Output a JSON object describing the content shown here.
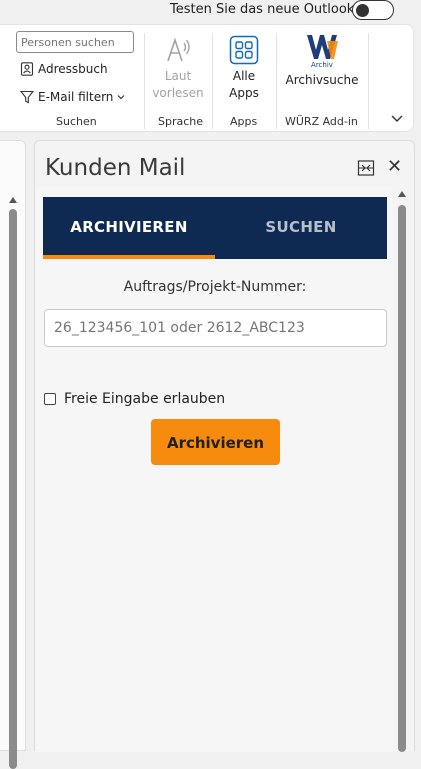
{
  "top": {
    "outlook_toggle_text": "Testen Sie das neue Outlook",
    "outlook_toggle_on": false
  },
  "ribbon": {
    "search_group": {
      "search_placeholder": "Personen suchen",
      "address_book": "Adressbuch",
      "filter_email": "E-Mail filtern",
      "group_label": "Suchen"
    },
    "speech_group": {
      "read_aloud_line1": "Laut",
      "read_aloud_line2": "vorlesen",
      "group_label": "Sprache"
    },
    "apps_group": {
      "all_apps_line1": "Alle",
      "all_apps_line2": "Apps",
      "group_label": "Apps"
    },
    "wurz_group": {
      "logo_text": "Archiv",
      "archive_search": "Archivsuche",
      "group_label": "WÜRZ Add-in"
    }
  },
  "pane": {
    "title": "Kunden Mail",
    "tabs": [
      {
        "label": "ARCHIVIEREN",
        "active": true
      },
      {
        "label": "SUCHEN",
        "active": false
      }
    ],
    "order_label": "Auftrags/Projekt-Nummer:",
    "order_placeholder": "26_123456_101 oder 2612_ABC123",
    "free_input_label": "Freie Eingabe erlauben",
    "free_input_checked": false,
    "archive_button": "Archivieren"
  },
  "colors": {
    "tab_bg": "#0f2a52",
    "accent_orange": "#f68b0e",
    "wurz_blue": "#1e3d7a"
  },
  "icons": [
    "toggle-icon",
    "address-book-icon",
    "filter-icon",
    "chevron-down-icon",
    "read-aloud-icon",
    "all-apps-icon",
    "wurz-archiv-logo",
    "pin-pane-icon",
    "close-icon"
  ]
}
